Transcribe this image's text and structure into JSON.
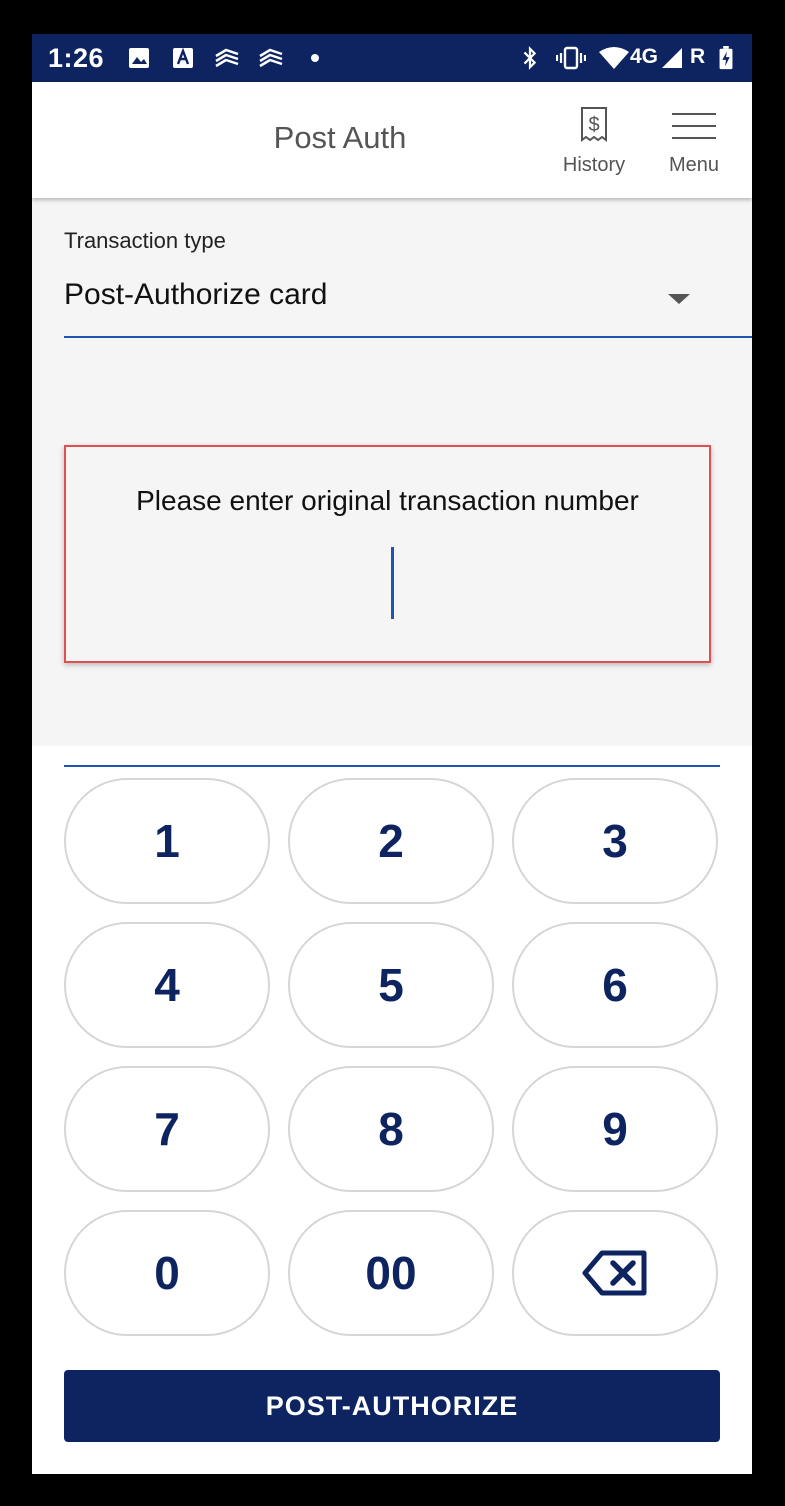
{
  "status_bar": {
    "time": "1:26",
    "network": "4G",
    "roaming": "R",
    "icons": [
      "image-icon",
      "text-app-icon",
      "bank-icon",
      "bank-icon",
      "dot-icon",
      "bluetooth-icon",
      "vibrate-icon",
      "wifi-icon",
      "signal-icon",
      "battery-charging-icon"
    ]
  },
  "app_bar": {
    "title": "Post Auth",
    "history_label": "History",
    "menu_label": "Menu"
  },
  "form": {
    "transaction_type_label": "Transaction type",
    "transaction_type_value": "Post-Authorize card",
    "prompt": "Please enter original transaction number",
    "input_value": ""
  },
  "keypad": {
    "keys": [
      "1",
      "2",
      "3",
      "4",
      "5",
      "6",
      "7",
      "8",
      "9",
      "0",
      "00"
    ],
    "backspace_icon": "backspace-icon"
  },
  "action": {
    "label": "POST-AUTHORIZE"
  },
  "colors": {
    "primary": "#0d2460",
    "accent": "#1e55b3",
    "highlight": "#e05050"
  }
}
